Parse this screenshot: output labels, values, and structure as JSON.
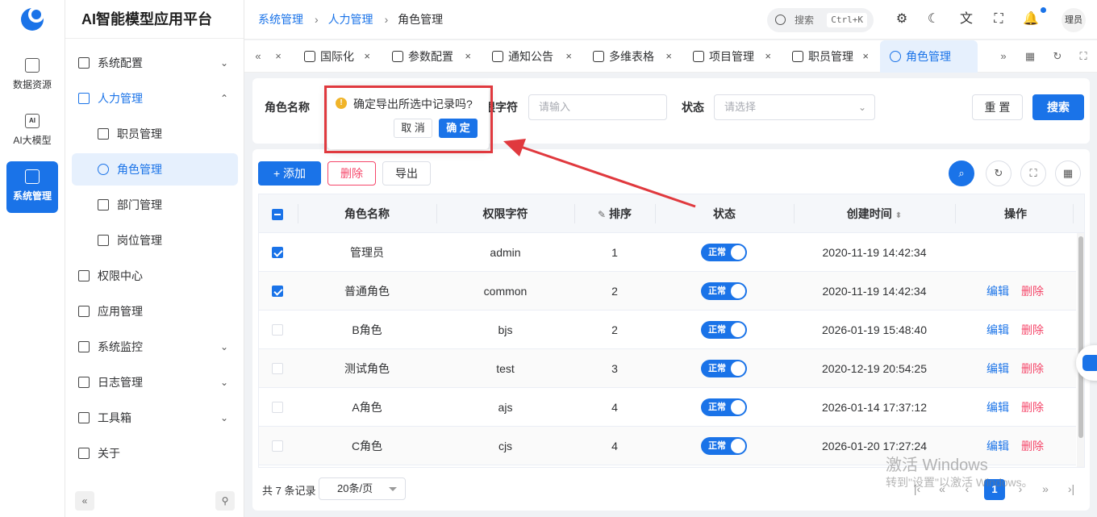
{
  "app": {
    "title": "AI智能模型应用平台"
  },
  "rail": [
    {
      "label": "数据资源",
      "icon": "database-icon"
    },
    {
      "label": "AI大模型",
      "icon": "ai-icon",
      "glyph": "AI"
    },
    {
      "label": "系统管理",
      "icon": "system-icon",
      "active": true
    }
  ],
  "sidebar": {
    "items": [
      {
        "label": "系统配置",
        "icon": "grid-icon",
        "chevron": "down"
      },
      {
        "label": "人力管理",
        "icon": "users-icon",
        "chevron": "up",
        "open": true
      },
      {
        "label": "职员管理",
        "icon": "id-card-icon",
        "sub": true
      },
      {
        "label": "角色管理",
        "icon": "user-role-icon",
        "sub": true,
        "active": true
      },
      {
        "label": "部门管理",
        "icon": "org-icon",
        "sub": true
      },
      {
        "label": "岗位管理",
        "icon": "compass-icon",
        "sub": true
      },
      {
        "label": "权限中心",
        "icon": "lock-icon"
      },
      {
        "label": "应用管理",
        "icon": "apps-icon"
      },
      {
        "label": "系统监控",
        "icon": "monitor-icon",
        "chevron": "down"
      },
      {
        "label": "日志管理",
        "icon": "log-icon",
        "chevron": "down"
      },
      {
        "label": "工具箱",
        "icon": "tools-icon",
        "chevron": "down"
      },
      {
        "label": "关于",
        "icon": "info-icon"
      }
    ],
    "collapse_glyph": "«",
    "pin_glyph": "⚲"
  },
  "breadcrumb": [
    {
      "label": "系统管理",
      "link": true
    },
    {
      "label": "人力管理",
      "link": true
    },
    {
      "label": "角色管理",
      "link": false
    }
  ],
  "header": {
    "search_placeholder": "搜索",
    "search_shortcut": "Ctrl+K",
    "avatar_text": "理员"
  },
  "tabs": [
    {
      "label": "国际化"
    },
    {
      "label": "参数配置"
    },
    {
      "label": "通知公告"
    },
    {
      "label": "多维表格"
    },
    {
      "label": "项目管理"
    },
    {
      "label": "职员管理"
    },
    {
      "label": "角色管理",
      "active": true
    }
  ],
  "filter": {
    "role_name_label": "角色名称",
    "perm_label": "限字符",
    "perm_placeholder": "请输入",
    "status_label": "状态",
    "status_placeholder": "请选择",
    "reset_label": "重 置",
    "search_label": "搜索"
  },
  "toolbar": {
    "add_label": "+ 添加",
    "delete_label": "删除",
    "export_label": "导出"
  },
  "table": {
    "columns": [
      "角色名称",
      "权限字符",
      "排序",
      "状态",
      "创建时间",
      "操作"
    ],
    "rows": [
      {
        "checked": true,
        "name": "管理员",
        "key": "admin",
        "sort": "1",
        "status": "正常",
        "created": "2020-11-19 14:42:34",
        "editable": false
      },
      {
        "checked": true,
        "name": "普通角色",
        "key": "common",
        "sort": "2",
        "status": "正常",
        "created": "2020-11-19 14:42:34",
        "editable": true
      },
      {
        "checked": false,
        "name": "B角色",
        "key": "bjs",
        "sort": "2",
        "status": "正常",
        "created": "2026-01-19 15:48:40",
        "editable": true
      },
      {
        "checked": false,
        "name": "测试角色",
        "key": "test",
        "sort": "3",
        "status": "正常",
        "created": "2020-12-19 20:54:25",
        "editable": true
      },
      {
        "checked": false,
        "name": "A角色",
        "key": "ajs",
        "sort": "4",
        "status": "正常",
        "created": "2026-01-14 17:37:12",
        "editable": true
      },
      {
        "checked": false,
        "name": "C角色",
        "key": "cjs",
        "sort": "4",
        "status": "正常",
        "created": "2026-01-20 17:27:24",
        "editable": true
      }
    ],
    "edit_label": "编辑",
    "delete_label": "删除"
  },
  "pagination": {
    "total": "共 7 条记录",
    "page_size": "20条/页",
    "current": "1"
  },
  "popconfirm": {
    "message": "确定导出所选中记录吗?",
    "cancel": "取 消",
    "confirm": "确 定"
  },
  "watermark": {
    "line1": "激活 Windows",
    "line2": "转到\"设置\"以激活 Windows。"
  },
  "colors": {
    "primary": "#1a73e8",
    "danger": "#f5476a",
    "highlight": "#e0393e"
  }
}
